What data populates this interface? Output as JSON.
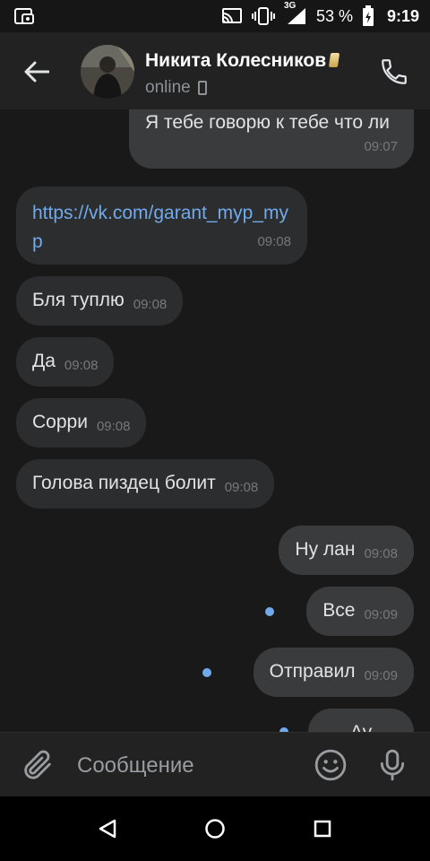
{
  "status_bar": {
    "network": "3G",
    "battery": "53 %",
    "time": "9:19",
    "icons": [
      "screen-cast-icon",
      "vibrate-icon",
      "signal-icon",
      "battery-icon",
      "notification-app-icon"
    ]
  },
  "header": {
    "contact_name": "Никита Колесников",
    "status": "online",
    "icons": [
      "back-arrow-icon",
      "avatar",
      "mobile-device-icon",
      "phone-call-icon"
    ]
  },
  "messages": [
    {
      "dir": "out",
      "text": "Я тебе говорю к тебе что ли",
      "time": "09:07"
    },
    {
      "dir": "in",
      "text": "https://vk.com/garant_myp_myp",
      "time": "09:08",
      "is_link": true
    },
    {
      "dir": "in",
      "text": "Бля туплю",
      "time": "09:08"
    },
    {
      "dir": "in",
      "text": "Да",
      "time": "09:08"
    },
    {
      "dir": "in",
      "text": "Сорри",
      "time": "09:08"
    },
    {
      "dir": "in",
      "text": "Голова пиздец болит",
      "time": "09:08"
    },
    {
      "dir": "out",
      "text": "Ну лан",
      "time": "09:08"
    },
    {
      "dir": "out",
      "text": "Все",
      "time": "09:09",
      "unread": true
    },
    {
      "dir": "out",
      "text": "Отправил",
      "time": "09:09",
      "unread": true
    },
    {
      "dir": "out",
      "text": "Ау",
      "time": "",
      "unread": true,
      "partial": true
    }
  ],
  "composer": {
    "placeholder": "Сообщение",
    "icons": [
      "paperclip-icon",
      "emoji-icon",
      "microphone-icon"
    ]
  },
  "colors": {
    "background": "#19191a",
    "header": "#222223",
    "bubble_in": "#2c2d2e",
    "bubble_out": "#3a3b3c",
    "link": "#71aaeb",
    "time": "#76787a"
  }
}
